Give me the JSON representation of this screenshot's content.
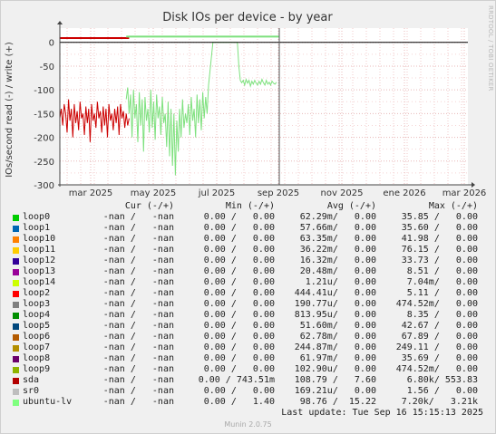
{
  "chart_data": {
    "type": "line",
    "title": "Disk IOs per device - by year",
    "ylabel": "IOs/second read (-) / write (+)",
    "ylim": [
      -300,
      30
    ],
    "y_ticks": [
      0,
      -50,
      -100,
      -150,
      -200,
      -250,
      -300
    ],
    "y_tick_labels": [
      "0",
      "-50",
      "-100",
      "-150",
      "-200",
      "-250",
      "-300"
    ],
    "x_ticks": [
      "mar 2025",
      "may 2025",
      "jul 2025",
      "sep 2025",
      "nov 2025",
      "ene 2026",
      "mar 2026"
    ],
    "grid": true,
    "series": [
      {
        "name": "sda",
        "color": "#cc0000",
        "read_x": [
          0,
          0.5,
          1,
          1.5,
          2,
          2.5,
          3,
          3.5,
          4,
          4.5,
          5,
          5.5,
          6,
          6.5,
          7,
          7.5,
          8,
          8.5,
          9,
          9.5,
          10,
          10.5,
          11,
          11.5,
          12,
          12.5,
          13,
          13.5,
          14,
          14.5,
          15,
          15.5,
          16,
          16.5,
          17,
          17.5,
          18,
          18.5,
          19,
          19.5,
          20,
          20.5,
          21,
          21.5,
          22,
          22.5,
          23,
          23.5,
          24
        ],
        "read_y": [
          -160,
          -140,
          -175,
          -130,
          -150,
          -190,
          -120,
          -165,
          -140,
          -200,
          -130,
          -170,
          -145,
          -185,
          -125,
          -160,
          -150,
          -195,
          -135,
          -170,
          -140,
          -210,
          -130,
          -165,
          -150,
          -180,
          -125,
          -160,
          -145,
          -190,
          -135,
          -175,
          -140,
          -200,
          -130,
          -165,
          -150,
          -185,
          -140,
          -170,
          -135,
          -195,
          -130,
          -160,
          -145,
          -180,
          -150,
          -175,
          -160
        ],
        "write_y": 9
      },
      {
        "name": "ubuntu-lv",
        "color": "#7ee17e",
        "read_x": [
          23,
          23.5,
          24,
          24.5,
          25,
          25.5,
          26,
          26.5,
          27,
          27.5,
          28,
          28.5,
          29,
          29.5,
          30,
          30.5,
          31,
          31.5,
          32,
          32.5,
          33,
          33.5,
          34,
          34.5,
          35,
          35.5,
          36,
          36.5,
          37,
          37.5,
          38,
          38.5,
          39,
          39.5,
          40,
          40.5,
          41,
          41.5,
          42,
          42.5,
          43,
          43.5,
          44,
          44.5,
          45,
          45.5,
          46,
          46.5,
          47,
          47.5,
          48,
          48.5,
          49,
          49.5,
          50,
          50.5,
          51,
          51.5,
          52,
          52.5,
          53,
          53.5,
          54,
          54.5,
          55,
          55.5,
          56,
          56.5,
          57,
          57.5,
          58,
          58.5,
          59,
          59.5,
          60,
          60.5,
          61,
          61.5,
          62,
          62.5,
          63,
          63.5,
          64,
          64.5,
          65,
          65.5,
          66,
          66.5,
          67,
          67.5,
          68,
          68.5,
          69,
          69.5,
          70,
          70.5,
          71,
          71.5,
          72,
          72.5,
          73,
          73.5,
          74,
          74.5,
          75,
          75.5,
          76
        ],
        "read_y": [
          -120,
          -95,
          -150,
          -110,
          -200,
          -100,
          -160,
          -130,
          -210,
          -105,
          -175,
          -120,
          -230,
          -115,
          -165,
          -140,
          -190,
          -100,
          -180,
          -125,
          -205,
          -110,
          -160,
          -135,
          -195,
          -115,
          -170,
          -150,
          -220,
          -125,
          -240,
          -140,
          -260,
          -150,
          -280,
          -165,
          -230,
          -140,
          -200,
          -120,
          -180,
          -150,
          -170,
          -130,
          -195,
          -115,
          -165,
          -140,
          -200,
          -110,
          -170,
          -120,
          -185,
          -105,
          -160,
          -115,
          -150,
          -90,
          -60,
          -30,
          0,
          0,
          0,
          0,
          0,
          0,
          0,
          0,
          0,
          0,
          0,
          0,
          0,
          0,
          0,
          0,
          0,
          0,
          -50,
          -80,
          -85,
          -80,
          -90,
          -78,
          -86,
          -80,
          -92,
          -82,
          -88,
          -80,
          -86,
          -90,
          -82,
          -88,
          -78,
          -85,
          -90,
          -80,
          -88,
          -84,
          -90,
          -82,
          -86,
          -88,
          -84
        ],
        "write_y": 12
      }
    ]
  },
  "legend": {
    "headers": {
      "cur": "Cur (-/+)",
      "min": "Min (-/+)",
      "avg": "Avg (-/+)",
      "max": "Max (-/+)"
    },
    "rows": [
      {
        "name": "loop0",
        "color": "#00cc00",
        "cur": "-nan /   -nan",
        "min": "0.00 /   0.00",
        "avg": "62.29m/   0.00",
        "max": "35.85 /   0.00"
      },
      {
        "name": "loop1",
        "color": "#0066b3",
        "cur": "-nan /   -nan",
        "min": "0.00 /   0.00",
        "avg": "57.66m/   0.00",
        "max": "35.60 /   0.00"
      },
      {
        "name": "loop10",
        "color": "#ff8000",
        "cur": "-nan /   -nan",
        "min": "0.00 /   0.00",
        "avg": "63.35m/   0.00",
        "max": "41.98 /   0.00"
      },
      {
        "name": "loop11",
        "color": "#ffcc00",
        "cur": "-nan /   -nan",
        "min": "0.00 /   0.00",
        "avg": "36.22m/   0.00",
        "max": "76.15 /   0.00"
      },
      {
        "name": "loop12",
        "color": "#330099",
        "cur": "-nan /   -nan",
        "min": "0.00 /   0.00",
        "avg": "16.32m/   0.00",
        "max": "33.73 /   0.00"
      },
      {
        "name": "loop13",
        "color": "#990099",
        "cur": "-nan /   -nan",
        "min": "0.00 /   0.00",
        "avg": "20.48m/   0.00",
        "max": "8.51 /   0.00"
      },
      {
        "name": "loop14",
        "color": "#ccff00",
        "cur": "-nan /   -nan",
        "min": "0.00 /   0.00",
        "avg": "1.21u/   0.00",
        "max": "7.04m/   0.00"
      },
      {
        "name": "loop2",
        "color": "#ff0000",
        "cur": "-nan /   -nan",
        "min": "0.00 /   0.00",
        "avg": "444.41u/   0.00",
        "max": "5.11 /   0.00"
      },
      {
        "name": "loop3",
        "color": "#808080",
        "cur": "-nan /   -nan",
        "min": "0.00 /   0.00",
        "avg": "190.77u/   0.00",
        "max": "474.52m/   0.00"
      },
      {
        "name": "loop4",
        "color": "#008f00",
        "cur": "-nan /   -nan",
        "min": "0.00 /   0.00",
        "avg": "813.95u/   0.00",
        "max": "8.35 /   0.00"
      },
      {
        "name": "loop5",
        "color": "#00487d",
        "cur": "-nan /   -nan",
        "min": "0.00 /   0.00",
        "avg": "51.60m/   0.00",
        "max": "42.67 /   0.00"
      },
      {
        "name": "loop6",
        "color": "#b35a00",
        "cur": "-nan /   -nan",
        "min": "0.00 /   0.00",
        "avg": "62.78m/   0.00",
        "max": "67.89 /   0.00"
      },
      {
        "name": "loop7",
        "color": "#b38f00",
        "cur": "-nan /   -nan",
        "min": "0.00 /   0.00",
        "avg": "244.87m/   0.00",
        "max": "249.11 /   0.00"
      },
      {
        "name": "loop8",
        "color": "#6b006b",
        "cur": "-nan /   -nan",
        "min": "0.00 /   0.00",
        "avg": "61.97m/   0.00",
        "max": "35.69 /   0.00"
      },
      {
        "name": "loop9",
        "color": "#8fb300",
        "cur": "-nan /   -nan",
        "min": "0.00 /   0.00",
        "avg": "102.90u/   0.00",
        "max": "474.52m/   0.00"
      },
      {
        "name": "sda",
        "color": "#b30000",
        "cur": "-nan /   -nan",
        "min": "0.00 / 743.51m",
        "avg": "108.79 /   7.60",
        "max": "6.80k/ 553.83"
      },
      {
        "name": "sr0",
        "color": "#bebebe",
        "cur": "-nan /   -nan",
        "min": "0.00 /   0.00",
        "avg": "169.21u/   0.00",
        "max": "1.56 /   0.00"
      },
      {
        "name": "ubuntu-lv",
        "color": "#80ff80",
        "cur": "-nan /   -nan",
        "min": "0.00 /   1.40",
        "avg": "98.76 /  15.22",
        "max": "7.20k/   3.21k"
      }
    ]
  },
  "last_update": "Last update: Tue Sep 16 15:15:13 2025",
  "side_text": "RRDTOOL / TOBI OETIKER",
  "footer": "Munin 2.0.75"
}
